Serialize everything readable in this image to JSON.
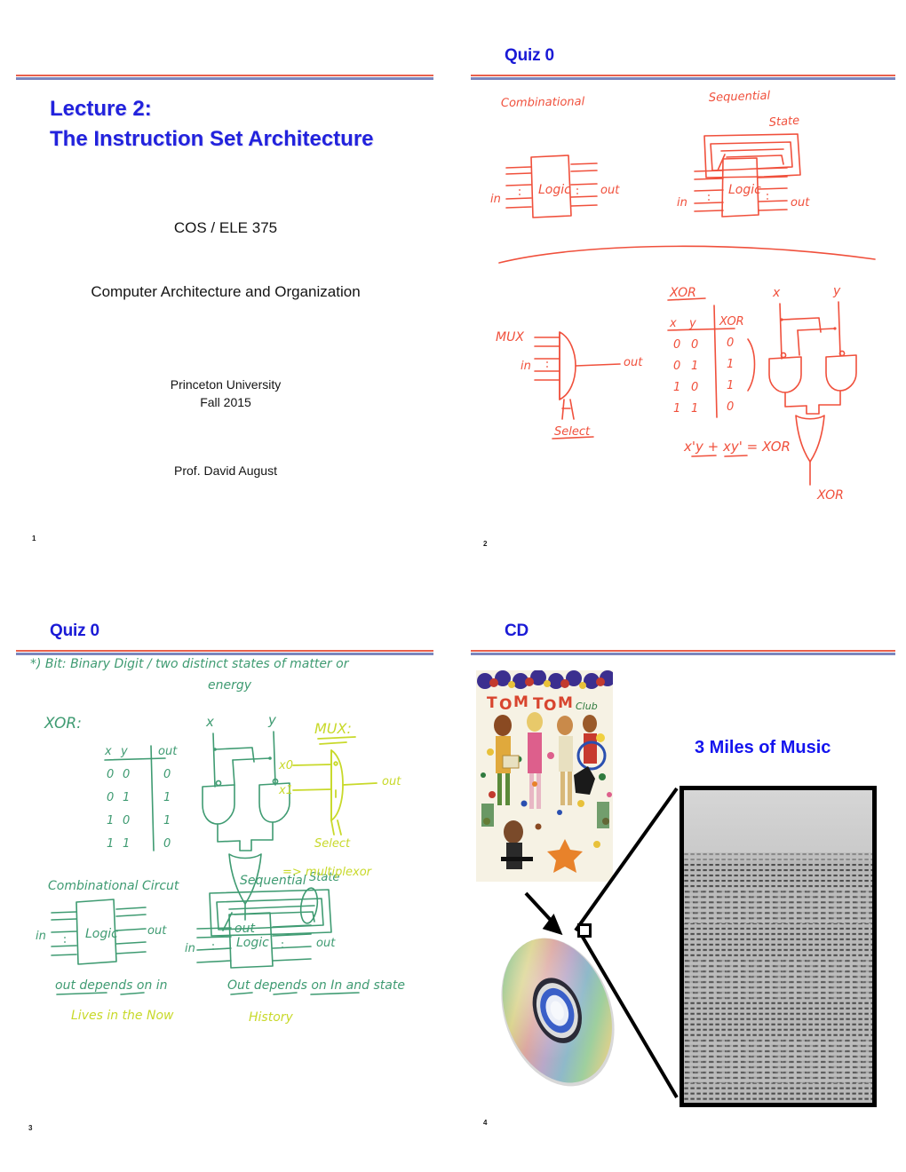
{
  "document": {
    "kind": "lecture-slide-handout",
    "slides_per_page": 4
  },
  "slide1": {
    "title_line1": "Lecture 2:",
    "title_line2": "The Instruction Set Architecture",
    "course": "COS / ELE 375",
    "course_name": "Computer Architecture and Organization",
    "university": "Princeton University",
    "term": "Fall 2015",
    "instructor": "Prof. David August",
    "page_number": "1",
    "title_color": "#2222dd"
  },
  "slide2": {
    "title": "Quiz 0",
    "page_number": "2",
    "ink_color": "#f0503c",
    "notes": {
      "combinational_label": "Combinational",
      "sequential_label": "Sequential",
      "state_label": "State",
      "logic_label": "Logic",
      "in_label": "in",
      "out_label": "out",
      "mux_label": "MUX",
      "select_label": "Select",
      "xor_label": "XOR",
      "xor_table": {
        "headers": [
          "x",
          "y",
          "XOR"
        ],
        "rows": [
          [
            "0",
            "0",
            "0"
          ],
          [
            "0",
            "1",
            "1"
          ],
          [
            "1",
            "0",
            "1"
          ],
          [
            "1",
            "1",
            "0"
          ]
        ]
      },
      "xor_equation": "x'y + xy' = XOR",
      "gate_input_x": "x",
      "gate_input_y": "y",
      "gate_output": "XOR"
    }
  },
  "slide3": {
    "title": "Quiz 0",
    "page_number": "3",
    "ink_color": "#3f9b72",
    "highlight_color": "#c8d92a",
    "notes": {
      "bit_line1": "*) Bit:  Binary Digit   / two distinct states of matter or",
      "bit_line2": "energy",
      "xor_label": "XOR:",
      "xor_table": {
        "headers": [
          "x",
          "y",
          "out"
        ],
        "rows": [
          [
            "0",
            "0",
            "0"
          ],
          [
            "0",
            "1",
            "1"
          ],
          [
            "1",
            "0",
            "1"
          ],
          [
            "1",
            "1",
            "0"
          ]
        ]
      },
      "gate_input_x": "x",
      "gate_input_y": "y",
      "gate_output": "out",
      "mux_label": "MUX:",
      "mux_in0": "x0",
      "mux_in1": "x1",
      "mux_out": "out",
      "mux_select": "Select",
      "mux_expand": "=> multiplexor",
      "comb_label": "Combinational Circut",
      "comb_logic": "Logic",
      "comb_in": "in",
      "comb_out": "out",
      "comb_note": "out depends on in",
      "comb_highlight": "Lives in the Now",
      "seq_label": "Sequential",
      "seq_state": "State",
      "seq_logic": "Logic",
      "seq_in": "in",
      "seq_out": "out",
      "seq_note": "Out depends on In and state",
      "seq_highlight": "History"
    }
  },
  "slide4": {
    "title": "CD",
    "page_number": "4",
    "headline": "3 Miles of Music",
    "headline_color": "#1414ee",
    "album_cover_alt": "tom-tom-club-album-cover",
    "cd_disc_alt": "compact-disc",
    "micrograph_alt": "cd-pit-micrograph"
  }
}
